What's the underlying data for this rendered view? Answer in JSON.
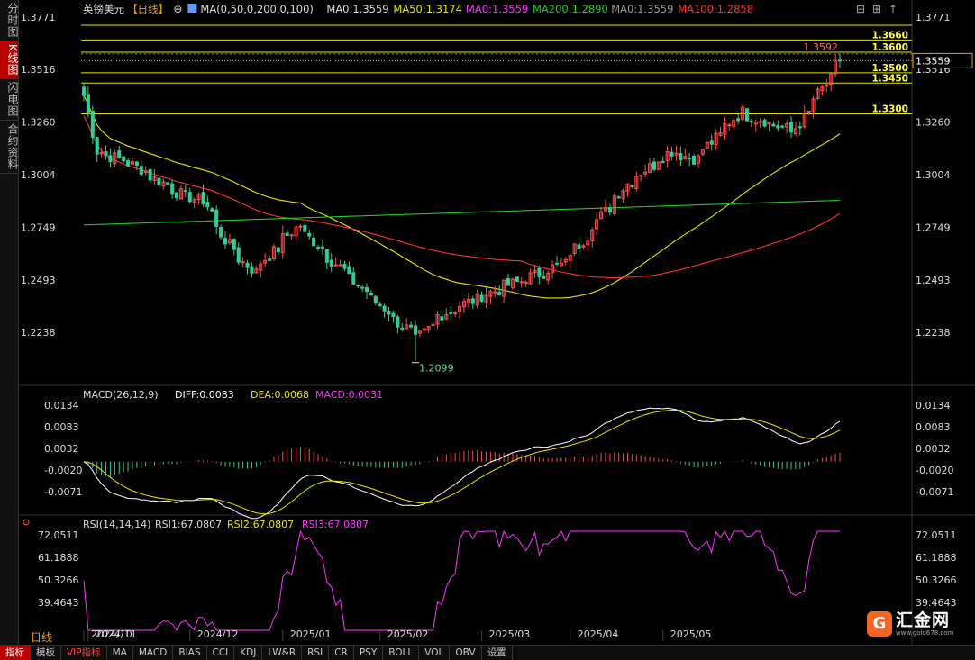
{
  "sidebar": {
    "tabs": [
      "分时图",
      "K线图",
      "闪电图",
      "合约资料"
    ],
    "active": 1
  },
  "header": {
    "name": "英镑美元",
    "period": "【日线】",
    "ma_settings": "MA(0,50,0,200,0,100)",
    "ma_items": [
      {
        "label": "MA0:1.3559",
        "color": "#dddddd"
      },
      {
        "label": "MA50:1.3174",
        "color": "#e6e600"
      },
      {
        "label": "MA0:1.3559",
        "color": "#ff33ff"
      },
      {
        "label": "MA200:1.2890",
        "color": "#22cc22"
      },
      {
        "label": "MA0:1.3559",
        "color": "#999999"
      },
      {
        "label": "MA100:1.2858",
        "color": "#ff3333"
      }
    ]
  },
  "price_axis": {
    "ticks": [
      "1.3771",
      "1.3516",
      "1.3260",
      "1.3004",
      "1.2749",
      "1.2493",
      "1.2238"
    ],
    "current": "1.3559"
  },
  "levels": [
    {
      "label": "1.3660",
      "value": 1.366
    },
    {
      "label": "1.3600",
      "value": 1.36
    },
    {
      "label": "1.3500",
      "value": 1.35
    },
    {
      "label": "1.3450",
      "value": 1.345
    },
    {
      "label": "1.3300",
      "value": 1.33
    }
  ],
  "annotations": {
    "high": "1.3592",
    "low": "1.2099"
  },
  "macd": {
    "title": "MACD(26,12,9)",
    "diff": "DIFF:0.0083",
    "dea": "DEA:0.0068",
    "macd": "MACD:0.0031",
    "ticks": [
      "0.0134",
      "0.0083",
      "0.0032",
      "-0.0020",
      "-0.0071"
    ]
  },
  "rsi": {
    "title": "RSI(14,14,14)",
    "rsi1": "RSI1:67.0807",
    "rsi2": "RSI2:67.0807",
    "rsi3": "RSI3:67.0807",
    "ticks": [
      "72.0511",
      "61.1888",
      "50.3266",
      "39.4643"
    ]
  },
  "x_labels": [
    "2024/10",
    "2024/11",
    "2024/12",
    "2025/01",
    "2025/02",
    "2025/03",
    "2025/04",
    "2025/05"
  ],
  "bottom": {
    "period_label": "日线",
    "tabs": [
      "指标",
      "模板",
      "VIP指标",
      "MA",
      "MACD",
      "BIAS",
      "CCI",
      "KDJ",
      "LW&R",
      "RSI",
      "CR",
      "PSY",
      "BOLL",
      "VOL",
      "OBV",
      "设置"
    ]
  },
  "logo": {
    "mark": "G",
    "name": "汇金网",
    "url": "www.gold678.com"
  },
  "chart_data": {
    "type": "candlestick",
    "title": "英镑美元 日线",
    "ylim": [
      1.2,
      1.378
    ],
    "key_points": [
      {
        "date": "2024/09/30",
        "close": 1.339
      },
      {
        "date": "2024/10/03",
        "close": 1.312
      },
      {
        "date": "2024/10/14",
        "close": 1.306
      },
      {
        "date": "2024/10/31",
        "close": 1.29
      },
      {
        "date": "2024/11/06",
        "close": 1.288
      },
      {
        "date": "2024/11/14",
        "close": 1.266
      },
      {
        "date": "2024/11/22",
        "close": 1.253
      },
      {
        "date": "2024/12/06",
        "close": 1.276
      },
      {
        "date": "2024/12/20",
        "close": 1.254
      },
      {
        "date": "2025/01/13",
        "close": 1.22
      },
      {
        "date": "2025/01/20",
        "close": 1.232
      },
      {
        "date": "2025/02/03",
        "close": 1.242
      },
      {
        "date": "2025/02/28",
        "close": 1.257
      },
      {
        "date": "2025/03/20",
        "close": 1.296
      },
      {
        "date": "2025/04/03",
        "close": 1.312
      },
      {
        "date": "2025/04/11",
        "close": 1.308
      },
      {
        "date": "2025/04/25",
        "close": 1.331
      },
      {
        "date": "2025/05/12",
        "close": 1.321
      },
      {
        "date": "2025/05/27",
        "close": 1.356
      }
    ],
    "high": 1.3592,
    "low": 1.2099
  }
}
